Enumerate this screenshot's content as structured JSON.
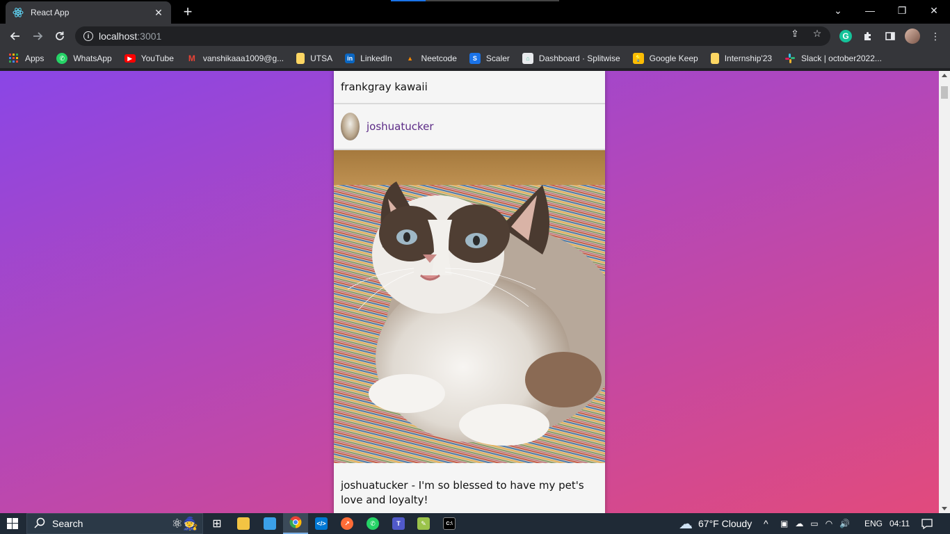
{
  "browser": {
    "tab_title": "React App",
    "tab_close": "✕",
    "new_tab": "+",
    "url_host": "localhost",
    "url_port": ":3001",
    "window_controls": {
      "dropdown": "⌄",
      "minimize": "—",
      "restore": "❐",
      "close": "✕"
    }
  },
  "bookmarks": [
    {
      "label": "Apps",
      "icon": "apps-grid-icon",
      "color": "#ea4335"
    },
    {
      "label": "WhatsApp",
      "icon": "whatsapp-icon",
      "color": "#25d366"
    },
    {
      "label": "YouTube",
      "icon": "youtube-icon",
      "color": "#ff0000"
    },
    {
      "label": "vanshikaaa1009@g...",
      "icon": "gmail-icon",
      "color": "#ffffff"
    },
    {
      "label": "UTSA",
      "icon": "folder-icon",
      "color": "#fdd663"
    },
    {
      "label": "LinkedIn",
      "icon": "linkedin-icon",
      "color": "#0a66c2"
    },
    {
      "label": "Neetcode",
      "icon": "neetcode-icon",
      "color": "#333333"
    },
    {
      "label": "Scaler",
      "icon": "scaler-icon",
      "color": "#1a73e8"
    },
    {
      "label": "Dashboard · Splitwise",
      "icon": "splitwise-icon",
      "color": "#5bc5a7"
    },
    {
      "label": "Google Keep",
      "icon": "google-keep-icon",
      "color": "#fbbc04"
    },
    {
      "label": "Internship'23",
      "icon": "folder-icon",
      "color": "#fdd663"
    },
    {
      "label": "Slack | october2022...",
      "icon": "slack-icon",
      "color": "#4a154b"
    }
  ],
  "page": {
    "comment_top": "frankgray kawaii",
    "post": {
      "username": "joshuatucker",
      "caption_user": "joshuatucker",
      "caption_text": "- I'm so blessed to have my pet's love and loyalty!"
    }
  },
  "taskbar": {
    "search_label": "Search",
    "weather": "67°F  Cloudy",
    "language": "ENG",
    "time": "04:11"
  },
  "colors": {
    "gradient_start": "#8a46e6",
    "gradient_end": "#e24a7c",
    "username": "#5b2a86"
  }
}
